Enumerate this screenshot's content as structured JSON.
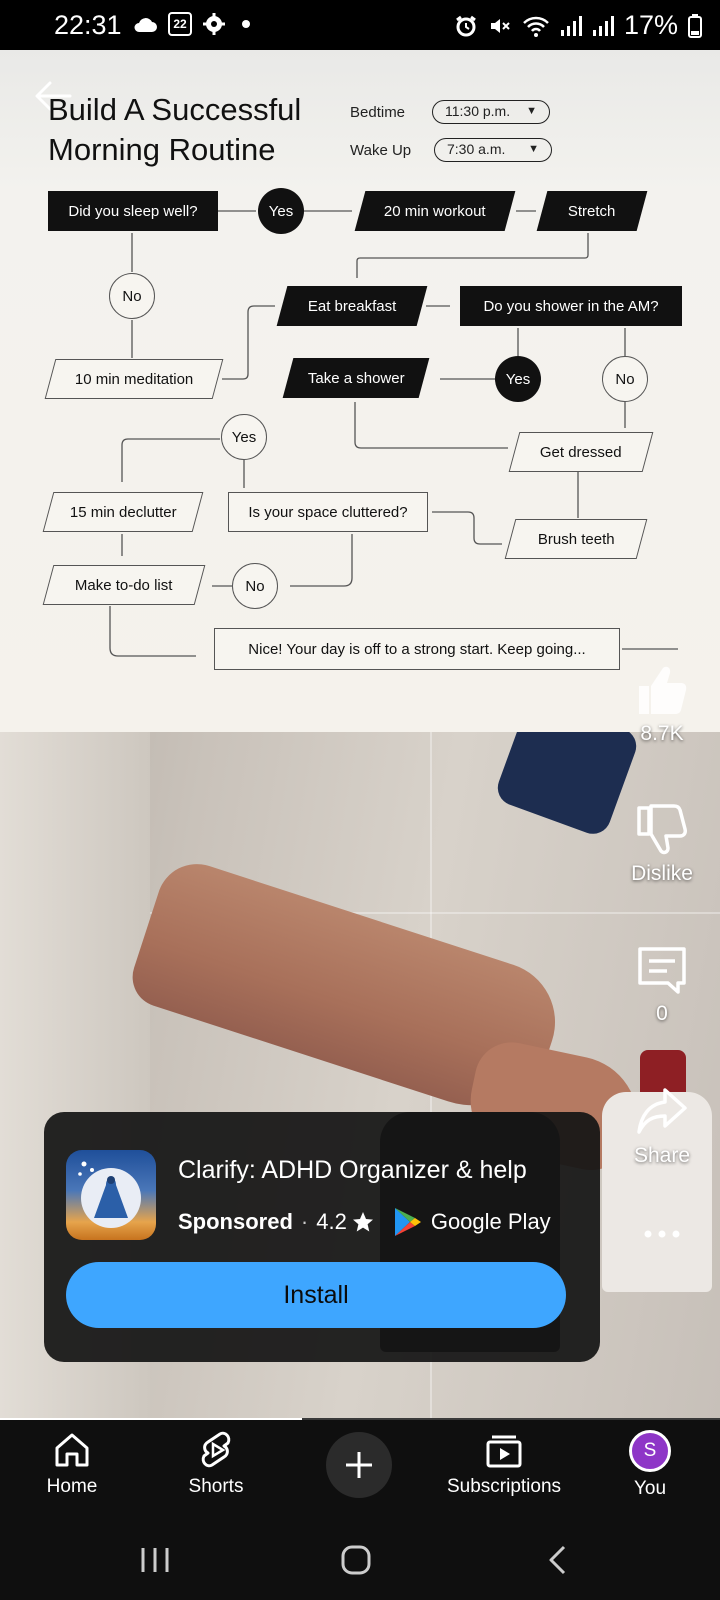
{
  "status_bar": {
    "time": "22:31",
    "calendar_day": "22",
    "battery": "17%",
    "icons": [
      "cloud-icon",
      "calendar-icon",
      "settings-icon",
      "dot-icon",
      "alarm-icon",
      "mute-icon",
      "wifi-icon",
      "signal-icon",
      "signal-icon",
      "battery-icon"
    ]
  },
  "infographic": {
    "title_line1": "Build A Successful",
    "title_line2": "Morning Routine",
    "bedtime_label": "Bedtime",
    "bedtime_value": "11:30 p.m.",
    "wakeup_label": "Wake Up",
    "wakeup_value": "7:30 a.m.",
    "nodes": {
      "sleep": "Did you sleep well?",
      "yes1": "Yes",
      "workout": "20 min workout",
      "stretch": "Stretch",
      "no1": "No",
      "breakfast": "Eat breakfast",
      "shower_q": "Do you shower in the AM?",
      "meditation": "10 min meditation",
      "take_shower": "Take a shower",
      "yes2": "Yes",
      "no2": "No",
      "yes3": "Yes",
      "dressed": "Get dressed",
      "declutter": "15 min declutter",
      "cluttered": "Is your space cluttered?",
      "brush": "Brush teeth",
      "todo": "Make to-do list",
      "no3": "No",
      "final": "Nice! Your day is off to a strong start. Keep going..."
    }
  },
  "rail": {
    "likes": "8.7K",
    "dislike_label": "Dislike",
    "comments": "0",
    "share_label": "Share"
  },
  "ad": {
    "app_name": "Clarify: ADHD Organizer & help",
    "sponsored": "Sponsored",
    "separator": "·",
    "rating": "4.2",
    "store": "Google Play",
    "install_label": "Install"
  },
  "playback": {
    "progress_fraction": 0.42
  },
  "bottom_nav": {
    "home": "Home",
    "shorts": "Shorts",
    "subscriptions": "Subscriptions",
    "you": "You",
    "avatar_letter": "S"
  },
  "colors": {
    "install_button": "#3ea6ff",
    "nav_background": "#0f0f0f",
    "avatar": "#8e36c7"
  }
}
